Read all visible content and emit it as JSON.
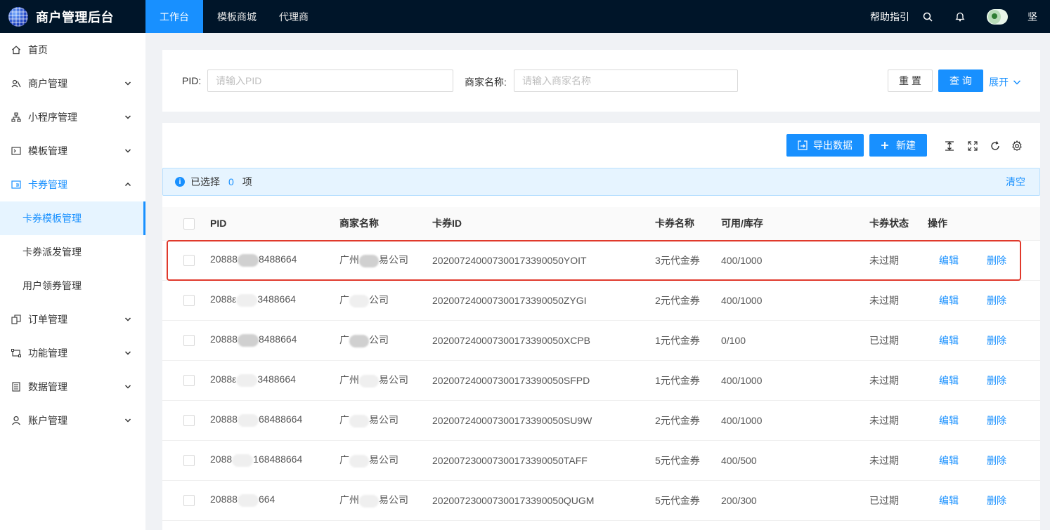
{
  "header": {
    "app_title": "商户管理后台",
    "nav": [
      {
        "label": "工作台",
        "active": true
      },
      {
        "label": "模板商城",
        "active": false
      },
      {
        "label": "代理商",
        "active": false
      }
    ],
    "help_label": "帮助指引",
    "username": "坚",
    "icons": [
      "search-icon",
      "bell-icon"
    ]
  },
  "sidebar": {
    "items": [
      {
        "label": "首页",
        "icon": "home-icon"
      },
      {
        "label": "商户管理",
        "icon": "merchant-icon"
      },
      {
        "label": "小程序管理",
        "icon": "miniprogram-icon"
      },
      {
        "label": "模板管理",
        "icon": "template-icon"
      },
      {
        "label": "卡券管理",
        "icon": "coupon-icon",
        "open": true
      },
      {
        "label": "订单管理",
        "icon": "order-icon"
      },
      {
        "label": "功能管理",
        "icon": "function-icon"
      },
      {
        "label": "数据管理",
        "icon": "data-icon"
      },
      {
        "label": "账户管理",
        "icon": "account-icon"
      }
    ],
    "subitems": [
      {
        "label": "卡券模板管理",
        "active": true
      },
      {
        "label": "卡券派发管理",
        "active": false
      },
      {
        "label": "用户领券管理",
        "active": false
      }
    ]
  },
  "search": {
    "pid_label": "PID",
    "pid_placeholder": "请输入PID",
    "merchant_label": "商家名称",
    "merchant_placeholder": "请输入商家名称",
    "reset_label": "重 置",
    "query_label": "查 询",
    "expand_label": "展开"
  },
  "toolbar": {
    "export_label": "导出数据",
    "new_label": "新建"
  },
  "alert": {
    "prefix": "已选择",
    "count": "0",
    "suffix": "项",
    "clear_label": "清空"
  },
  "table": {
    "columns": [
      "PID",
      "商家名称",
      "卡券ID",
      "卡券名称",
      "可用/库存",
      "卡券状态",
      "操作"
    ],
    "edit_label": "编辑",
    "delete_label": "删除",
    "rows": [
      {
        "pid_a": "20888",
        "pid_b": "8488664",
        "name_a": "广州",
        "name_b": "易公司",
        "coupon_id": "20200724000730017339005​0YOIT",
        "coupon_name": "3元代金券",
        "stock": "400/1000",
        "status": "未过期"
      },
      {
        "pid_a": "2088ε",
        "pid_b": "3488664",
        "name_a": "广",
        "name_b": "公司",
        "coupon_id": "2020072400073001733900​50ZYGI",
        "coupon_name": "2元代金券",
        "stock": "400/1000",
        "status": "未过期"
      },
      {
        "pid_a": "20888",
        "pid_b": "8488664",
        "name_a": "广",
        "name_b": "公司",
        "coupon_id": "2020072400073001733900​50XCPB",
        "coupon_name": "1元代金券",
        "stock": "0/100",
        "status": "已过期"
      },
      {
        "pid_a": "2088ε",
        "pid_b": "3488664",
        "name_a": "广州",
        "name_b": "易公司",
        "coupon_id": "2020072400073001733900​50SFPD",
        "coupon_name": "1元代金券",
        "stock": "400/1000",
        "status": "未过期"
      },
      {
        "pid_a": "20888",
        "pid_b": "68488664",
        "name_a": "广",
        "name_b": "易公司",
        "coupon_id": "2020072400073001733900​50SU9W",
        "coupon_name": "2元代金券",
        "stock": "400/1000",
        "status": "未过期"
      },
      {
        "pid_a": "2088",
        "pid_b": "168488664",
        "name_a": "广",
        "name_b": "易公司",
        "coupon_id": "2020072300073001733900​50TAFF",
        "coupon_name": "5元代金券",
        "stock": "400/500",
        "status": "未过期"
      },
      {
        "pid_a": "20888",
        "pid_b": "664",
        "name_a": "广州",
        "name_b": "易公司",
        "coupon_id": "2020072300073001733900​50QUGM",
        "coupon_name": "5元代金券",
        "stock": "200/300",
        "status": "已过期"
      }
    ]
  },
  "colors": {
    "primary": "#1890ff",
    "topbar": "#001529",
    "highlight": "#e0392c"
  }
}
